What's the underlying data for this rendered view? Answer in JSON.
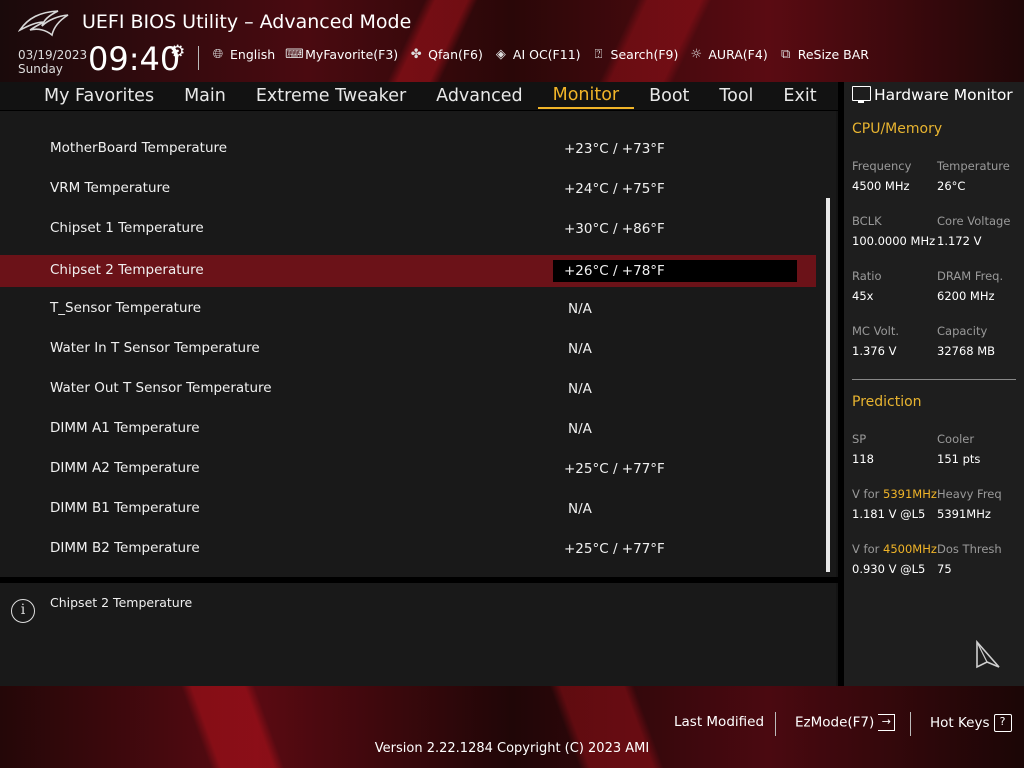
{
  "header": {
    "title": "UEFI BIOS Utility – Advanced Mode",
    "date": "03/19/2023",
    "day": "Sunday",
    "time": "09:40"
  },
  "toolbar": [
    {
      "icon": "globe-icon",
      "label": "English"
    },
    {
      "icon": "keyboard-icon",
      "label": "MyFavorite(F3)"
    },
    {
      "icon": "fan-icon",
      "label": "Qfan(F6)"
    },
    {
      "icon": "ai-oc-icon",
      "label": "AI OC(F11)"
    },
    {
      "icon": "question-box-icon",
      "label": "Search(F9)"
    },
    {
      "icon": "aura-light-icon",
      "label": "AURA(F4)"
    },
    {
      "icon": "resize-bar-icon",
      "label": "ReSize BAR"
    }
  ],
  "menu": {
    "items": [
      "My Favorites",
      "Main",
      "Extreme Tweaker",
      "Advanced",
      "Monitor",
      "Boot",
      "Tool",
      "Exit"
    ],
    "active": "Monitor"
  },
  "settings": [
    {
      "label": "MotherBoard Temperature",
      "value": "+23°C / +73°F",
      "selected": false
    },
    {
      "label": "VRM Temperature",
      "value": "+24°C / +75°F",
      "selected": false
    },
    {
      "label": "Chipset 1 Temperature",
      "value": "+30°C / +86°F",
      "selected": false
    },
    {
      "label": "Chipset 2 Temperature",
      "value": "+26°C / +78°F",
      "selected": true
    },
    {
      "label": "T_Sensor Temperature",
      "value": "N/A",
      "selected": false
    },
    {
      "label": "Water In T Sensor Temperature",
      "value": "N/A",
      "selected": false
    },
    {
      "label": "Water Out T Sensor Temperature",
      "value": "N/A",
      "selected": false
    },
    {
      "label": "DIMM A1 Temperature",
      "value": "N/A",
      "selected": false
    },
    {
      "label": "DIMM A2 Temperature",
      "value": "+25°C / +77°F",
      "selected": false
    },
    {
      "label": "DIMM B1 Temperature",
      "value": "N/A",
      "selected": false
    },
    {
      "label": "DIMM B2 Temperature",
      "value": "+25°C / +77°F",
      "selected": false
    }
  ],
  "help": {
    "text": "Chipset 2 Temperature"
  },
  "hardware_monitor": {
    "title": "Hardware Monitor",
    "cpu_memory": {
      "heading": "CPU/Memory",
      "items": [
        {
          "label": "Frequency",
          "value": "4500 MHz"
        },
        {
          "label": "Temperature",
          "value": "26°C"
        },
        {
          "label": "BCLK",
          "value": "100.0000 MHz"
        },
        {
          "label": "Core Voltage",
          "value": "1.172 V"
        },
        {
          "label": "Ratio",
          "value": "45x"
        },
        {
          "label": "DRAM Freq.",
          "value": "6200 MHz"
        },
        {
          "label": "MC Volt.",
          "value": "1.376 V"
        },
        {
          "label": "Capacity",
          "value": "32768 MB"
        }
      ]
    },
    "prediction": {
      "heading": "Prediction",
      "sp_label": "SP",
      "sp_value": "118",
      "cooler_label": "Cooler",
      "cooler_value": "151 pts",
      "v_for_prefix": "V for ",
      "v1_freq": "5391MHz",
      "v1_value": "1.181 V @L5",
      "heavy_freq_label": "Heavy Freq",
      "heavy_freq_value": "5391MHz",
      "v2_freq": "4500MHz",
      "v2_value": "0.930 V @L5",
      "dos_thresh_label": "Dos Thresh",
      "dos_thresh_value": "75"
    }
  },
  "footer": {
    "last_modified": "Last Modified",
    "ezmode": "EzMode(F7)",
    "hot_keys": "Hot Keys",
    "version": "Version 2.22.1284 Copyright (C) 2023 AMI"
  },
  "colors": {
    "accent": "#f0b428",
    "selected_row": "#6b1218",
    "brand_red": "#5a0b12"
  }
}
